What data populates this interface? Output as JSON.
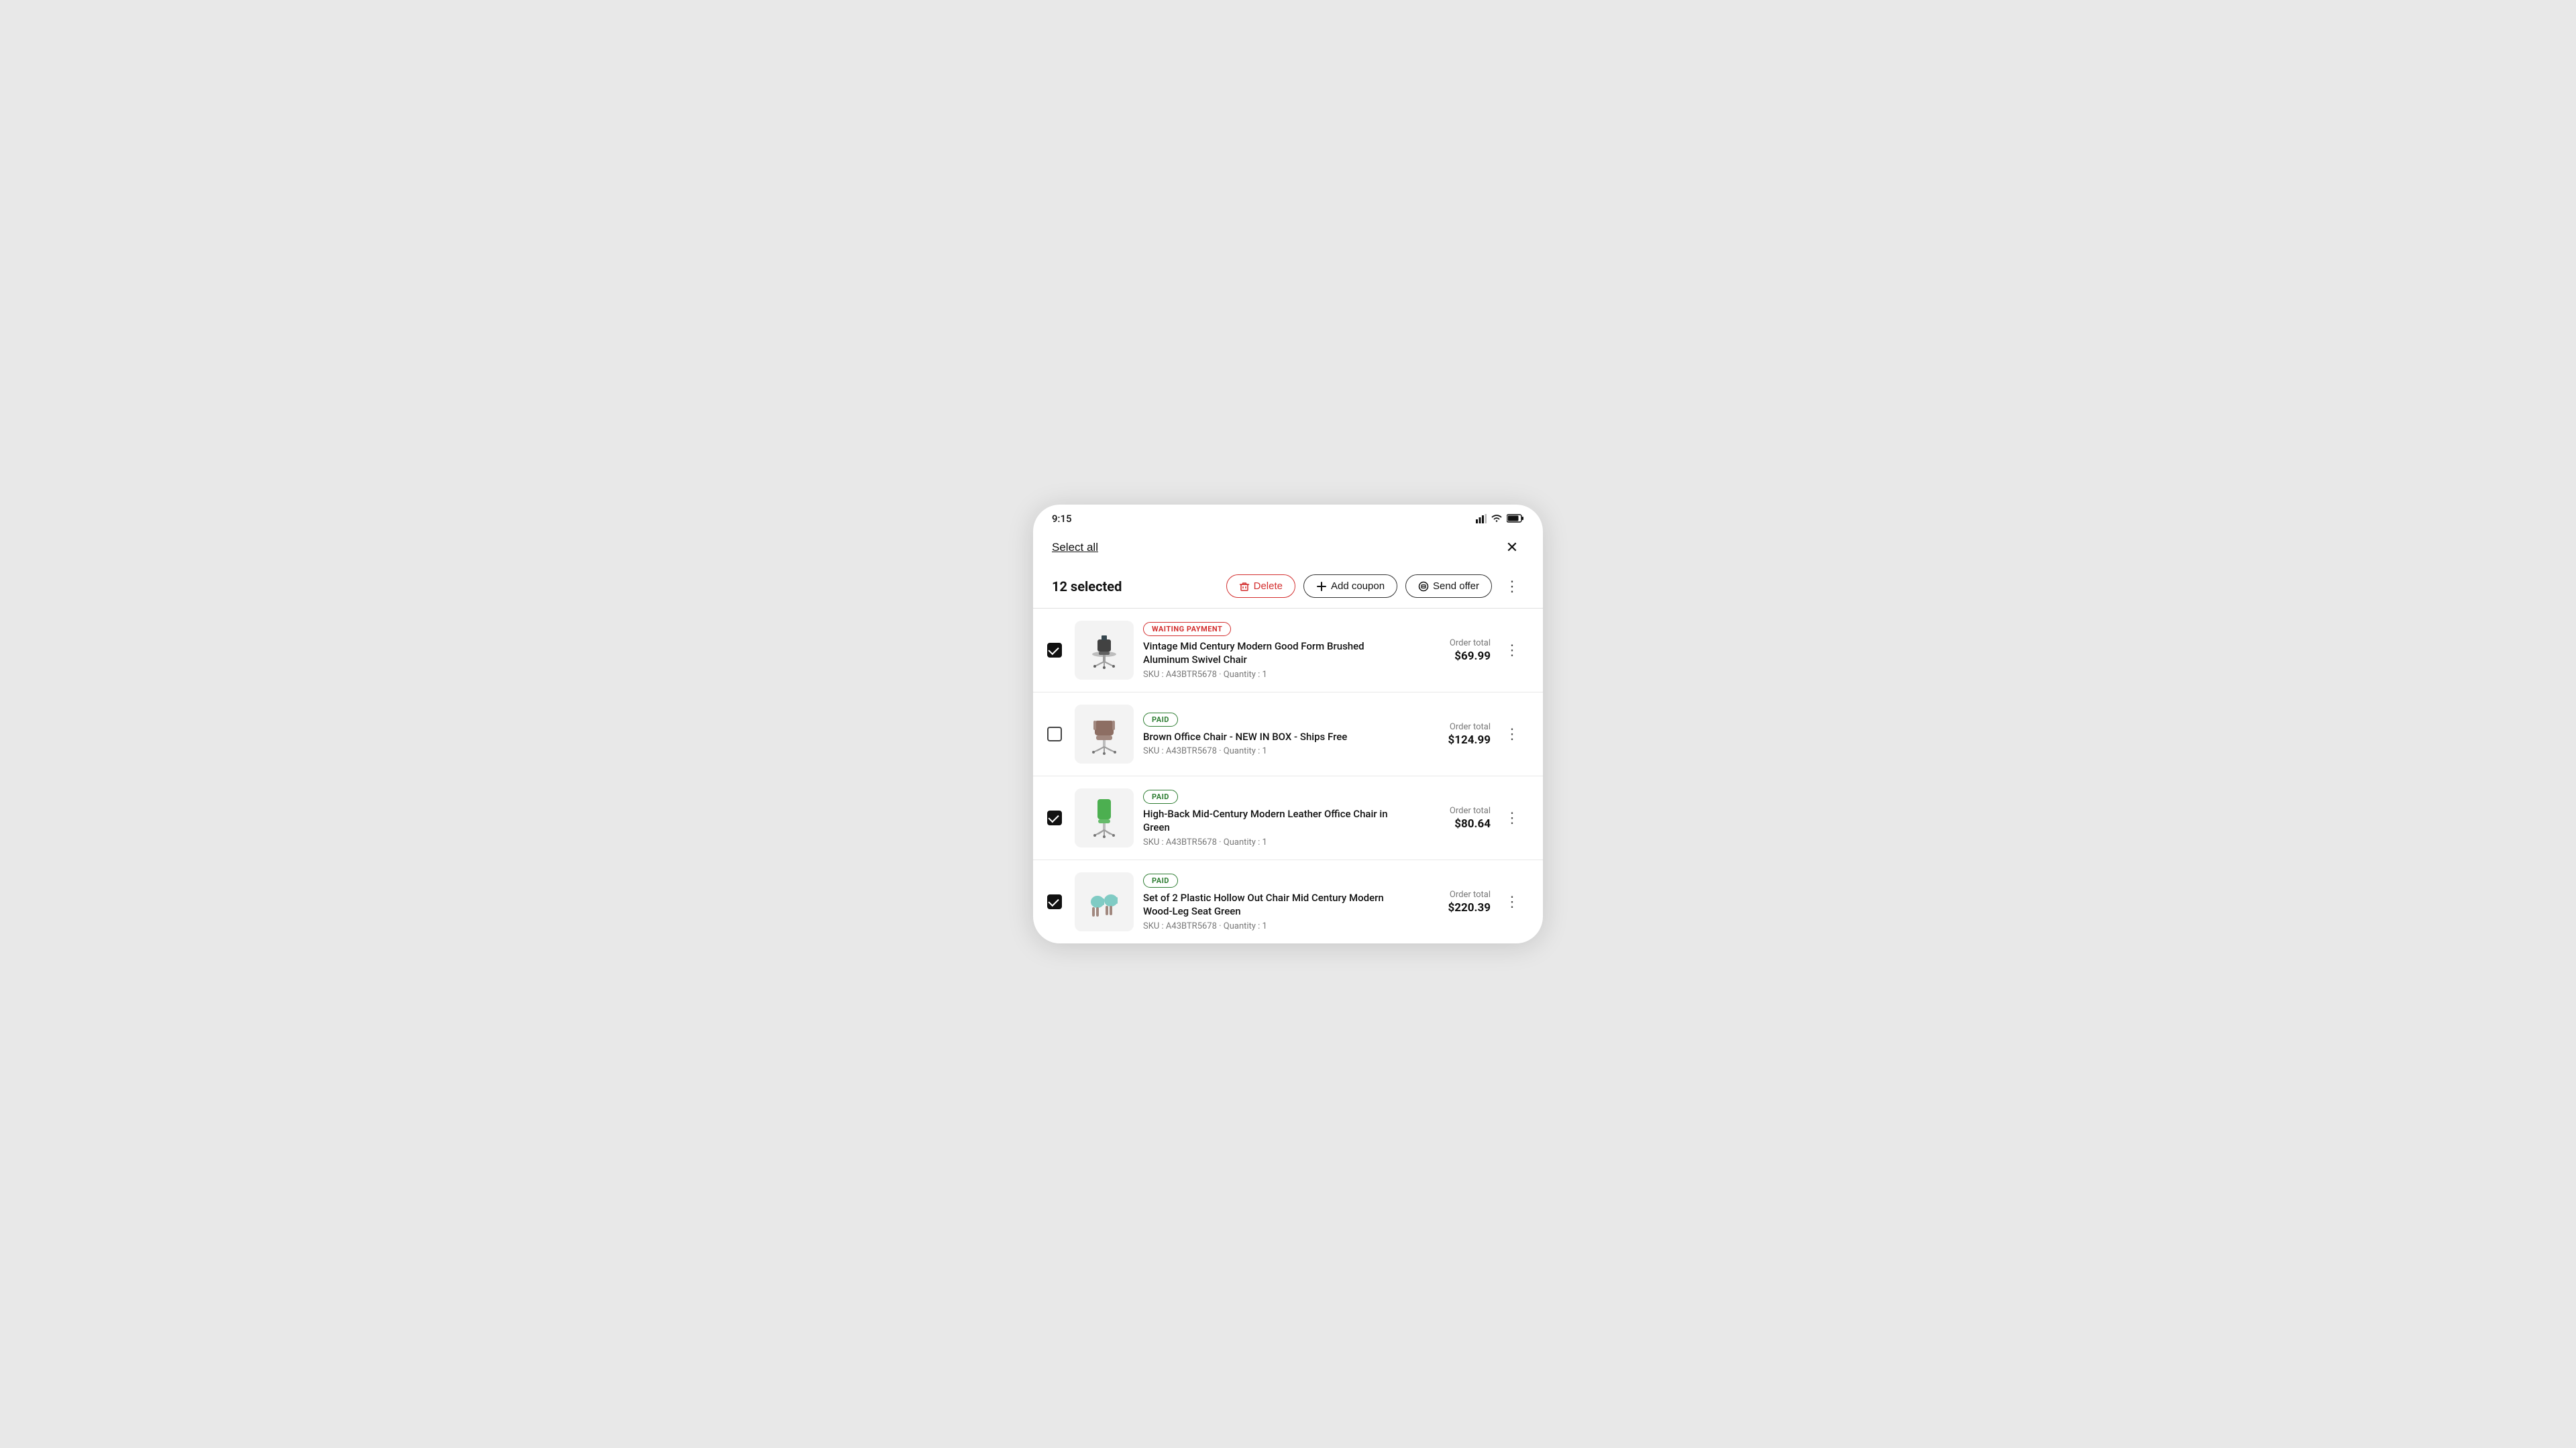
{
  "device": {
    "statusBar": {
      "time": "9:15"
    }
  },
  "header": {
    "selectAll": "Select all",
    "close": "✕"
  },
  "actionsBar": {
    "selectedCount": "12 selected",
    "deleteLabel": "Delete",
    "addCouponLabel": "Add coupon",
    "sendOfferLabel": "Send offer"
  },
  "orders": [
    {
      "id": "order-1",
      "checked": true,
      "statusBadge": "WAITING PAYMENT",
      "statusType": "waiting",
      "productName": "Vintage Mid Century Modern Good Form Brushed Aluminum Swivel Chair",
      "sku": "SKU : A43BTR5678",
      "quantity": "Quantity : 1",
      "orderTotalLabel": "Order total",
      "orderTotalAmount": "$69.99",
      "imgType": "swivel-chair"
    },
    {
      "id": "order-2",
      "checked": false,
      "statusBadge": "PAID",
      "statusType": "paid",
      "productName": "Brown Office Chair - NEW IN BOX - Ships Free",
      "sku": "SKU : A43BTR5678",
      "quantity": "Quantity : 1",
      "orderTotalLabel": "Order total",
      "orderTotalAmount": "$124.99",
      "imgType": "brown-chair"
    },
    {
      "id": "order-3",
      "checked": true,
      "statusBadge": "PAID",
      "statusType": "paid",
      "productName": "High-Back Mid-Century Modern Leather Office Chair in Green",
      "sku": "SKU : A43BTR5678",
      "quantity": "Quantity : 1",
      "orderTotalLabel": "Order total",
      "orderTotalAmount": "$80.64",
      "imgType": "green-chair"
    },
    {
      "id": "order-4",
      "checked": true,
      "statusBadge": "PAID",
      "statusType": "paid",
      "productName": "Set of 2 Plastic Hollow Out Chair Mid Century Modern Wood-Leg Seat Green",
      "sku": "SKU : A43BTR5678",
      "quantity": "Quantity : 1",
      "orderTotalLabel": "Order total",
      "orderTotalAmount": "$220.39",
      "imgType": "plastic-chairs"
    }
  ]
}
